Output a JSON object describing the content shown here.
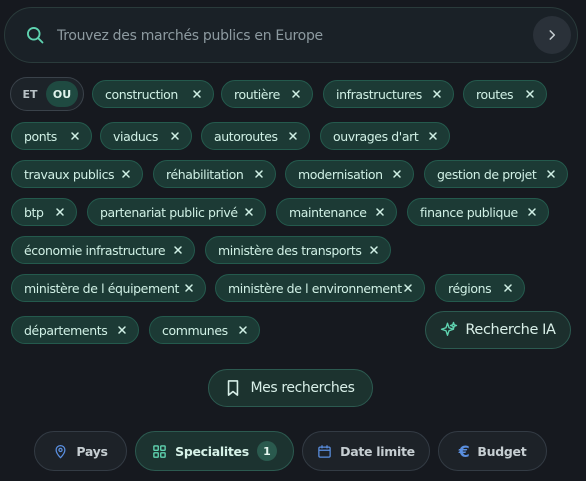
{
  "search": {
    "placeholder": "Trouvez des marchés publics en Europe",
    "value": ""
  },
  "logic_toggle": {
    "et_label": "ET",
    "ou_label": "OU",
    "selected": "OU"
  },
  "chips": [
    "construction",
    "routière",
    "infrastructures",
    "routes",
    "ponts",
    "viaducs",
    "autoroutes",
    "ouvrages d'art",
    "travaux publics",
    "réhabilitation",
    "modernisation",
    "gestion de projet",
    "btp",
    "partenariat public privé",
    "maintenance",
    "finance publique",
    "économie infrastructure",
    "ministère des transports",
    "ministère de l équipement",
    "ministère de l environnement",
    "régions",
    "départements",
    "communes"
  ],
  "actions": {
    "ai_search_label": "Recherche IA",
    "saved_searches_label": "Mes recherches"
  },
  "filters": {
    "pays_label": "Pays",
    "specialites_label": "Specialites",
    "specialites_count": "1",
    "date_label": "Date limite",
    "budget_label": "Budget"
  },
  "icons": {
    "search": "search-icon",
    "arrow": "chevron-right-icon",
    "remove": "close-icon",
    "ai": "sparkles-icon",
    "saved": "bookmark-icon",
    "pays": "map-pin-icon",
    "specialites": "grid-icon",
    "date": "calendar-icon",
    "budget": "euro-icon"
  },
  "colors": {
    "background": "#16191f",
    "accent": "#5fd3b0",
    "chip_bg": "#1c3a35"
  }
}
